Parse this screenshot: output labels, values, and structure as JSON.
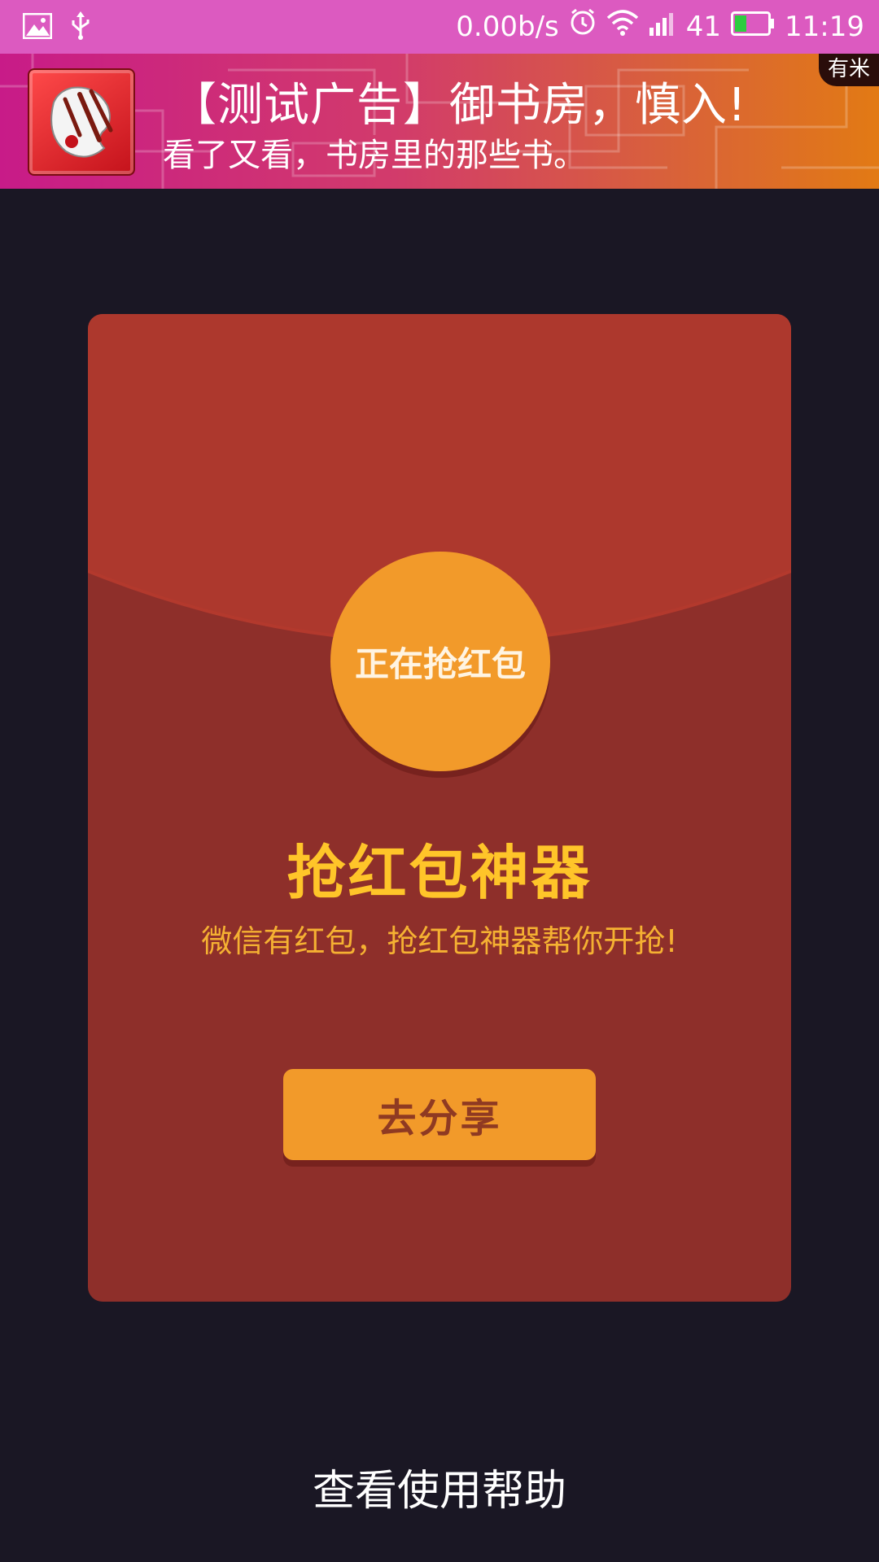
{
  "status_bar": {
    "left_icons": [
      "image-icon",
      "usb-icon"
    ],
    "net_speed": "0.00b/s",
    "signal_text": "41",
    "time": "11:19",
    "battery_color": "#2ecc40"
  },
  "ad_banner": {
    "title": "【测试广告】御书房，慎入!",
    "subtitle": "看了又看，书房里的那些书。",
    "badge": "有米",
    "icon": "palette-icon"
  },
  "card": {
    "grab_label": "正在抢红包",
    "title": "抢红包神器",
    "subtitle": "微信有红包，抢红包神器帮你开抢!",
    "share_button": "去分享",
    "colors": {
      "top": "#ad382d",
      "bottom": "#8e2f2a",
      "accent": "#f29a2a",
      "title": "#ffc529"
    }
  },
  "help_link": "查看使用帮助"
}
